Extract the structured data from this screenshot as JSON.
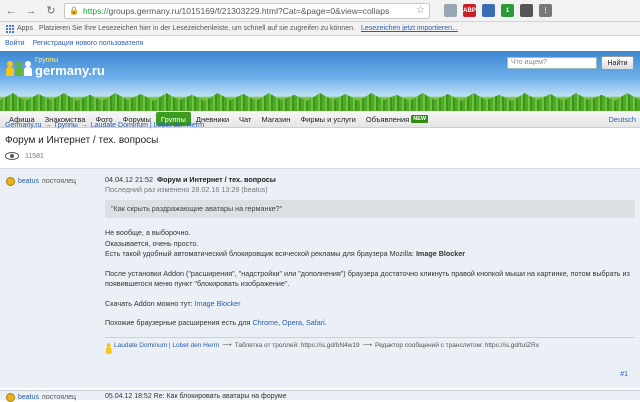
{
  "browser": {
    "url_scheme": "https://",
    "url_rest": "groups.germany.ru/1015169/f/21303229.html?Cat=&page=0&view=collaps",
    "extensions": [
      {
        "name": "ext-gray",
        "color": "#9aa6b3",
        "label": ""
      },
      {
        "name": "ext-abp",
        "color": "#c8202a",
        "label": "ABP"
      },
      {
        "name": "ext-shield",
        "color": "#3a6fb5",
        "label": ""
      },
      {
        "name": "ext-green",
        "color": "#2d9a3a",
        "label": "1"
      },
      {
        "name": "ext-user",
        "color": "#555555",
        "label": ""
      },
      {
        "name": "ext-menu",
        "color": "#777777",
        "label": "⋮"
      }
    ]
  },
  "bookmarks": {
    "apps": "Apps",
    "hint": "Platzieren Sie Ihre Lesezeichen hier in der Lesezeichenleiste, um schnell auf sie zugreifen zu können.",
    "import_link": "Lesezeichen jetzt importieren..."
  },
  "login": {
    "login": "Войти",
    "register": "Регистрация нового пользователя"
  },
  "header": {
    "logo_small": "Группы",
    "logo_big": "germany.ru",
    "search_placeholder": "Что ищем?",
    "search_button": "Найти"
  },
  "menu": {
    "items": [
      "Афиша",
      "Знакомства",
      "Фото",
      "Форумы",
      "Группы",
      "Дневники",
      "Чат",
      "Магазин",
      "Фирмы и услуги",
      "Объявления"
    ],
    "active_index": 4,
    "new_badge": "NEW",
    "right": "Deutsch"
  },
  "breadcrumb": {
    "items": [
      "Germany.ru",
      "Группы",
      "Laudate Dominum | Lobet den Herrn"
    ],
    "sep": "→"
  },
  "page": {
    "title": "Форум и Интернет / тех. вопросы",
    "views": "11581"
  },
  "post": {
    "author": "beatus",
    "role": "постоялец",
    "date": "04.04.12 21:52",
    "subject": "Форум и Интернет / тех. вопросы",
    "edited": "Последний раз изменено 28.02.16 13:29 (beatus)",
    "quote": "\"Как скрыть раздражающие аватары на германке?\"",
    "p1_l1": "Не вообще, а выборочно.",
    "p1_l2": "Оказывается, очень просто.",
    "p1_l3_text": "Есть такой удобный автоматический блокировщик всяческой рекламы для браузера Mozilla: ",
    "p1_l3_bold": "Image Blocker",
    "p2": "После установки Addon (\"расширения\", \"надстройки\" или \"дополнения\") браузера достаточно кликнуть правой кнопкой мыши на картинке, потом выбрать из появившегося меню пункт \"блокировать изображение\".",
    "p3_text": "Скачать Addon можно тут: ",
    "p3_link": "Image Blocker",
    "p4_text": "Похожие браузерные расширения есть для ",
    "p4_links": [
      "Chrome",
      "Opera",
      "Safari"
    ],
    "p4_sep1": ", ",
    "p4_sep2": ", ",
    "p4_end": ".",
    "footer_group": "Laudate Dominum | Lobet den Herrn",
    "footer_mid": "Таблетка от троллей: https://is.gd/bN4w19",
    "footer_end": "Редактор сообщений с транслитом: https://is.gd/tuIZRx",
    "arrow": "⟶",
    "num": "#1"
  },
  "next_post": {
    "author": "beatus",
    "role": "постоялец",
    "preview": "05.04.12 18:52  Re: Как блокировать аватары на форуме"
  }
}
